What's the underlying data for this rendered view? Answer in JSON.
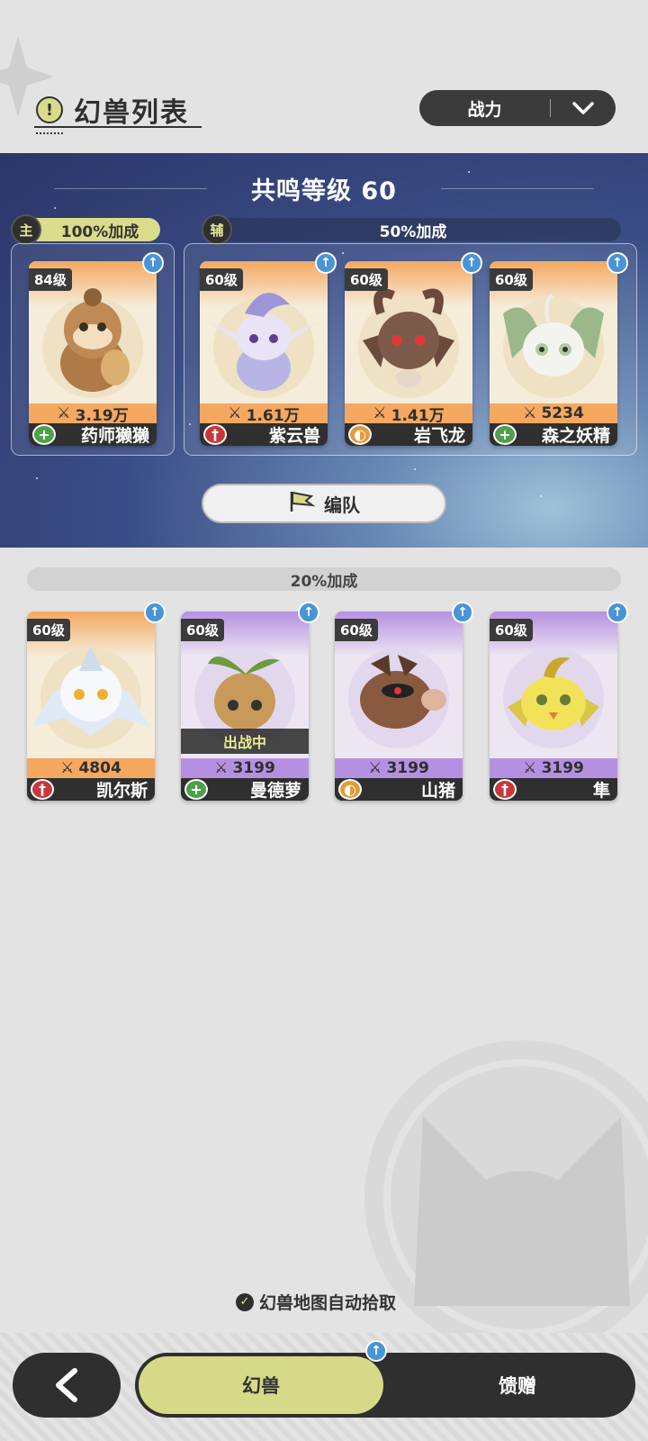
{
  "header": {
    "title": "幻兽列表",
    "title_icon": "exclamation-icon",
    "sort_label": "战力"
  },
  "banner": {
    "resonance_label": "共鸣等级 60",
    "main_tag": "主",
    "main_bonus": "100%加成",
    "support_tag": "辅",
    "support_bonus": "50%加成",
    "team_button": "编队"
  },
  "main_card": {
    "level": "84级",
    "power": "3.19万",
    "name": "药师獭獭",
    "role": "heal"
  },
  "support_cards": [
    {
      "level": "60级",
      "power": "1.61万",
      "name": "紫云兽",
      "role": "attack"
    },
    {
      "level": "60级",
      "power": "1.41万",
      "name": "岩飞龙",
      "role": "defense"
    },
    {
      "level": "60级",
      "power": "5234",
      "name": "森之妖精",
      "role": "heal"
    }
  ],
  "reserve": {
    "bonus": "20%加成",
    "cards": [
      {
        "level": "60级",
        "power": "4804",
        "name": "凯尔斯",
        "role": "attack",
        "deployed": ""
      },
      {
        "level": "60级",
        "power": "3199",
        "name": "曼德萝",
        "role": "heal",
        "deployed": "出战中"
      },
      {
        "level": "60级",
        "power": "3199",
        "name": "山猪",
        "role": "defense",
        "deployed": ""
      },
      {
        "level": "60级",
        "power": "3199",
        "name": "隼",
        "role": "attack",
        "deployed": ""
      }
    ]
  },
  "footer": {
    "auto_pickup": "幻兽地图自动拾取",
    "tab_beasts": "幻兽",
    "tab_gift": "馈赠"
  },
  "colors": {
    "accent": "#d6d987",
    "dark": "#2f2f2f",
    "orange_card": "#f4a860",
    "purple_card": "#b590e0",
    "heal": "#4ea04b",
    "attack": "#c8383b",
    "defense": "#e39b3d",
    "upgrade": "#4a94d6"
  }
}
